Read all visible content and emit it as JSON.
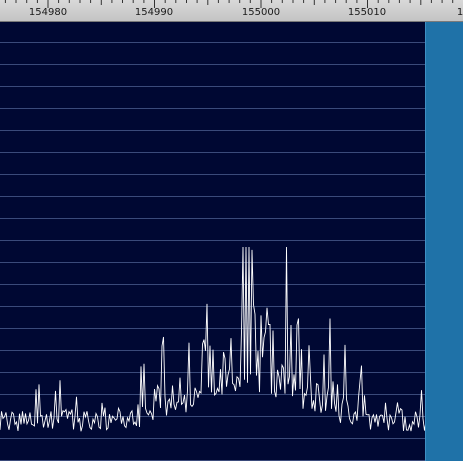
{
  "frequency_ruler": {
    "tick_labels": [
      "154980",
      "154990",
      "155000",
      "155010",
      "1"
    ]
  },
  "spectrum": {
    "background_color": "#000833",
    "grid_color": "#3a4a7a",
    "trace_color": "#ffffff",
    "filter_band_color": "#1f72a8",
    "description_hint": "spectrum trace centered at 155000"
  },
  "chart_data": {
    "type": "line",
    "x_axis_ticks": [
      154980,
      154990,
      155000,
      155010
    ],
    "xlabel": "",
    "ylabel": "",
    "grid": true
  }
}
